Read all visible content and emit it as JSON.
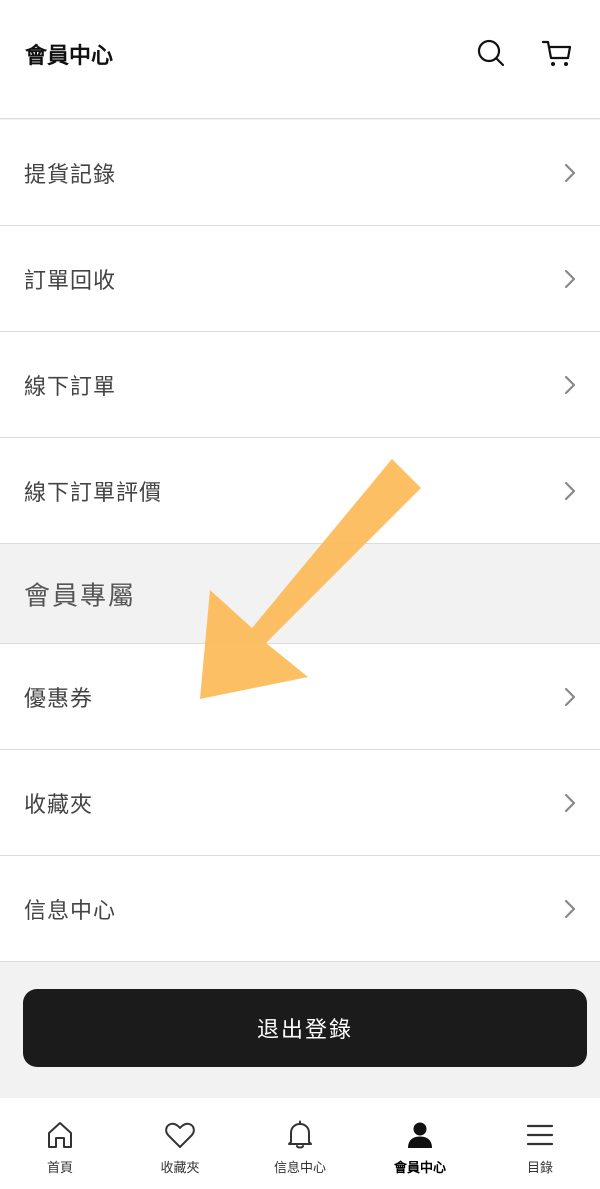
{
  "header": {
    "title": "會員中心",
    "search_icon": "search-icon",
    "cart_icon": "cart-icon"
  },
  "menu": {
    "items_top": [
      {
        "label": "提貨記錄"
      },
      {
        "label": "訂單回收"
      },
      {
        "label": "線下訂單"
      },
      {
        "label": "線下訂單評價"
      }
    ],
    "section_title": "會員專屬",
    "items_member": [
      {
        "label": "優惠券"
      },
      {
        "label": "收藏夾"
      },
      {
        "label": "信息中心"
      }
    ]
  },
  "logout": {
    "label": "退出登錄"
  },
  "annotation": {
    "arrow_color": "#FDBA56"
  },
  "tabbar": {
    "tabs": [
      {
        "label": "首頁",
        "icon": "home-icon"
      },
      {
        "label": "收藏夾",
        "icon": "heart-icon"
      },
      {
        "label": "信息中心",
        "icon": "bell-icon"
      },
      {
        "label": "會員中心",
        "icon": "user-icon",
        "active": true
      },
      {
        "label": "目錄",
        "icon": "menu-icon"
      }
    ]
  }
}
